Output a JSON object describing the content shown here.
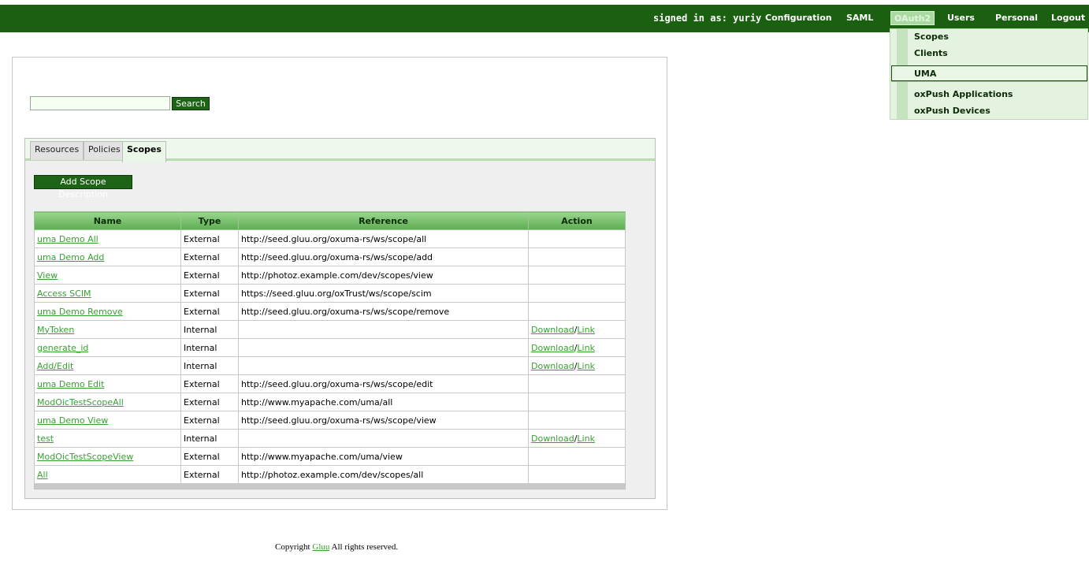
{
  "header": {
    "signed_in": "signed in as: yuriy",
    "nav": [
      "Configuration",
      "SAML",
      "OAuth2",
      "Users",
      "Personal",
      "Logout"
    ]
  },
  "dropdown": {
    "items": [
      "Scopes",
      "Clients",
      "UMA",
      "oxPush Applications",
      "oxPush Devices"
    ]
  },
  "search": {
    "value": "",
    "button_label": "Search"
  },
  "tabs": [
    "Resources",
    "Policies",
    "Scopes"
  ],
  "add_button_label": "Add Scope Description",
  "table": {
    "columns": [
      "Name",
      "Type",
      "Reference",
      "Action"
    ],
    "rows": [
      {
        "name": "uma Demo All",
        "type": "External",
        "reference": "http://seed.gluu.org/oxuma-rs/ws/scope/all",
        "actions": false
      },
      {
        "name": "uma Demo Add",
        "type": "External",
        "reference": "http://seed.gluu.org/oxuma-rs/ws/scope/add",
        "actions": false
      },
      {
        "name": "View",
        "type": "External",
        "reference": "http://photoz.example.com/dev/scopes/view",
        "actions": false
      },
      {
        "name": "Access SCIM",
        "type": "External",
        "reference": "https://seed.gluu.org/oxTrust/ws/scope/scim",
        "actions": false
      },
      {
        "name": "uma Demo Remove",
        "type": "External",
        "reference": "http://seed.gluu.org/oxuma-rs/ws/scope/remove",
        "actions": false
      },
      {
        "name": "MyToken",
        "type": "Internal",
        "reference": "",
        "actions": true
      },
      {
        "name": "generate_id",
        "type": "Internal",
        "reference": "",
        "actions": true
      },
      {
        "name": "Add/Edit",
        "type": "Internal",
        "reference": "",
        "actions": true
      },
      {
        "name": "uma Demo Edit",
        "type": "External",
        "reference": "http://seed.gluu.org/oxuma-rs/ws/scope/edit",
        "actions": false
      },
      {
        "name": "ModOicTestScopeAll",
        "type": "External",
        "reference": "http://www.myapache.com/uma/all",
        "actions": false
      },
      {
        "name": "uma Demo View",
        "type": "External",
        "reference": "http://seed.gluu.org/oxuma-rs/ws/scope/view",
        "actions": false
      },
      {
        "name": "test",
        "type": "Internal",
        "reference": "",
        "actions": true
      },
      {
        "name": "ModOicTestScopeView",
        "type": "External",
        "reference": "http://www.myapache.com/uma/view",
        "actions": false
      },
      {
        "name": "All",
        "type": "External",
        "reference": "http://photoz.example.com/dev/scopes/all",
        "actions": false
      }
    ],
    "action_labels": {
      "download": "Download",
      "separator": "/",
      "link": "Link"
    }
  },
  "footer": {
    "prefix": "Copyright ",
    "link": "Gluu",
    "suffix": " All rights reserved."
  },
  "colors": {
    "topbar": "#1a6010",
    "accent": "#39a033",
    "dropdown_bg": "#e4f3e0"
  }
}
